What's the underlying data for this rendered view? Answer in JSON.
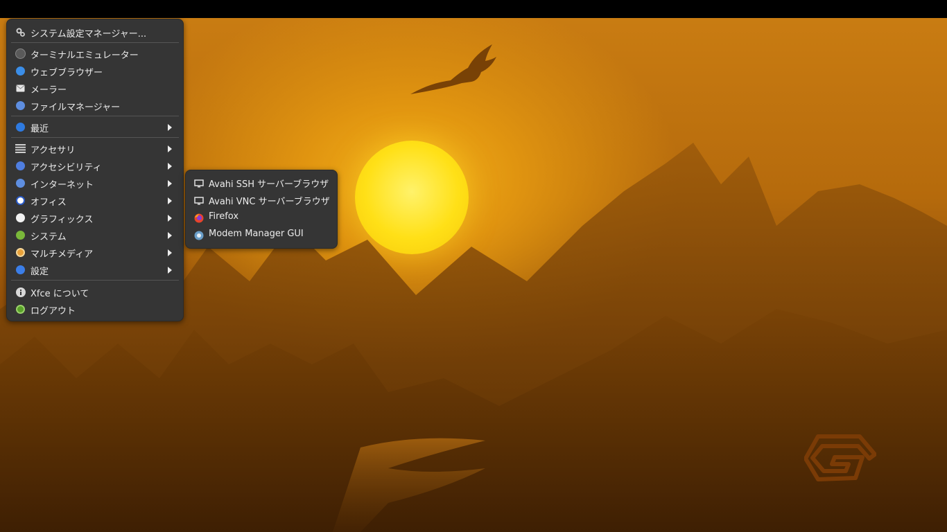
{
  "desktop": {
    "wallpaper": "sunset mountains with eagle",
    "colors": {
      "sky": "#c97c12",
      "sun": "#ffe017",
      "menu_bg": "#353535",
      "text": "#ececec"
    }
  },
  "menu": {
    "settings_item": {
      "label": "システム設定マネージャー...",
      "icon": "settings-gear-icon"
    },
    "favorites": [
      {
        "label": "ターミナルエミュレーター",
        "icon": "terminal-icon"
      },
      {
        "label": "ウェブブラウザー",
        "icon": "web-browser-icon"
      },
      {
        "label": "メーラー",
        "icon": "mail-icon"
      },
      {
        "label": "ファイルマネージャー",
        "icon": "file-manager-icon"
      }
    ],
    "recent": {
      "label": "最近",
      "icon": "recent-icon"
    },
    "categories": [
      {
        "label": "アクセサリ",
        "icon": "list-icon"
      },
      {
        "label": "アクセシビリティ",
        "icon": "accessibility-icon"
      },
      {
        "label": "インターネット",
        "icon": "internet-icon"
      },
      {
        "label": "オフィス",
        "icon": "office-icon"
      },
      {
        "label": "グラフィックス",
        "icon": "graphics-icon"
      },
      {
        "label": "システム",
        "icon": "system-icon"
      },
      {
        "label": "マルチメディア",
        "icon": "multimedia-icon"
      },
      {
        "label": "設定",
        "icon": "settings-icon"
      }
    ],
    "about": {
      "label": "Xfce について",
      "icon": "info-icon"
    },
    "logout": {
      "label": "ログアウト",
      "icon": "logout-icon"
    }
  },
  "submenu": {
    "items": [
      {
        "label": "Avahi SSH サーバーブラウザ",
        "icon": "monitor-icon"
      },
      {
        "label": "Avahi VNC サーバーブラウザ",
        "icon": "monitor-icon"
      },
      {
        "label": "Firefox",
        "icon": "firefox-icon"
      },
      {
        "label": "Modem Manager GUI",
        "icon": "modem-manager-icon"
      }
    ]
  }
}
